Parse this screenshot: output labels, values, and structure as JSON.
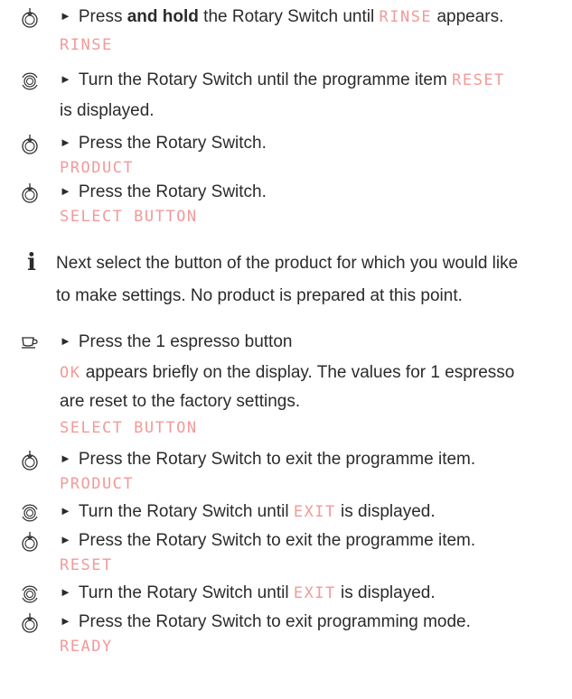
{
  "steps": [
    {
      "icon": "rotary-press-icon",
      "before": "Press ",
      "bold": "and hold",
      "after": " the Rotary Switch until ",
      "disp": "RINSE",
      "tail": " appears.",
      "display_line": "RINSE"
    },
    {
      "icon": "rotary-turn-icon",
      "text": "Turn the Rotary Switch until the programme item ",
      "disp": "RESET",
      "cont": "is displayed."
    },
    {
      "icon": "rotary-press-icon",
      "text": "Press the Rotary Switch.",
      "display_line": "PRODUCT"
    },
    {
      "icon": "rotary-press-icon",
      "text": "Press the Rotary Switch.",
      "display_line": "SELECT BUTTON"
    },
    {
      "info_line1": "Next select the button of the product for which you would like",
      "info_line2": "to make settings. No product is prepared at this point."
    },
    {
      "icon": "espresso-cup-icon",
      "text": "Press the 1 espresso button",
      "disp": "OK",
      "cont1": " appears briefly on the display. The values for 1 espresso",
      "cont2": "are reset to the factory settings.",
      "display_line": "SELECT BUTTON"
    },
    {
      "icon": "rotary-press-icon",
      "text": "Press the Rotary Switch to exit the programme item.",
      "display_line": "PRODUCT"
    },
    {
      "icon": "rotary-turn-icon",
      "before": "Turn the Rotary Switch until ",
      "disp": "EXIT",
      "after": " is displayed."
    },
    {
      "icon": "rotary-press-icon",
      "text": "Press the Rotary Switch to exit the programme item.",
      "display_line": "RESET"
    },
    {
      "icon": "rotary-turn-icon",
      "before": "Turn the Rotary Switch until ",
      "disp": "EXIT",
      "after": " is displayed."
    },
    {
      "icon": "rotary-press-icon",
      "text": "Press the Rotary Switch to exit programming mode.",
      "display_line": "READY"
    }
  ],
  "glyphs": {
    "arrow": "►",
    "info": "i"
  },
  "colors": {
    "text": "#2b2b2b",
    "display": "#f29a9a"
  }
}
